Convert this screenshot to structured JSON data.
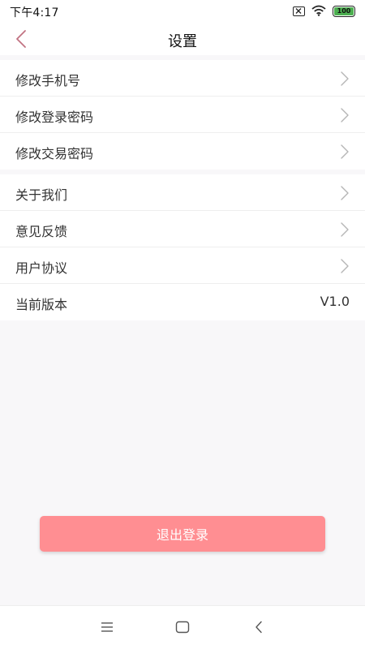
{
  "status_bar": {
    "time": "下午4:17",
    "battery_level": "100",
    "icons": [
      "sim-icon",
      "wifi-icon",
      "battery-icon"
    ]
  },
  "header": {
    "title": "设置",
    "back_icon": "chevron-left-icon"
  },
  "groups": [
    {
      "items": [
        {
          "label": "修改手机号",
          "icon": "chevron-right-icon"
        },
        {
          "label": "修改登录密码",
          "icon": "chevron-right-icon"
        },
        {
          "label": "修改交易密码",
          "icon": "chevron-right-icon"
        }
      ]
    },
    {
      "items": [
        {
          "label": "关于我们",
          "icon": "chevron-right-icon"
        },
        {
          "label": "意见反馈",
          "icon": "chevron-right-icon"
        },
        {
          "label": "用户协议",
          "icon": "chevron-right-icon"
        },
        {
          "label": "当前版本",
          "value": "V1.0"
        }
      ]
    }
  ],
  "logout_label": "退出登录",
  "system_nav": {
    "icons": [
      "menu-icon",
      "home-icon",
      "back-icon"
    ]
  },
  "colors": {
    "accent": "#ff8e92",
    "back_arrow": "#c27382",
    "background": "#f8f7f9",
    "divider": "#eeeeee"
  }
}
